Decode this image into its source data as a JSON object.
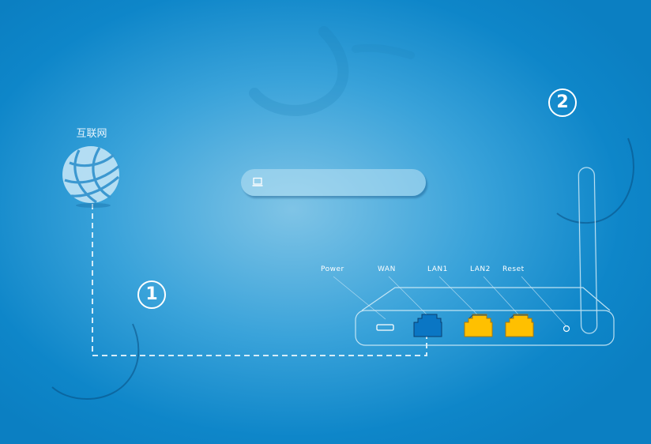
{
  "internet": {
    "label": "互联网",
    "icon": "globe-icon"
  },
  "steps": [
    {
      "number": "1",
      "text": ""
    },
    {
      "number": "2",
      "text": ""
    }
  ],
  "device_bar": {
    "icon": "laptop-icon",
    "text": ""
  },
  "router": {
    "ports": [
      "Power",
      "WAN",
      "LAN1",
      "LAN2",
      "Reset"
    ],
    "colors": {
      "wan": "#0a76c4",
      "lan": "#ffc000",
      "line": "#cfeaf8"
    }
  }
}
